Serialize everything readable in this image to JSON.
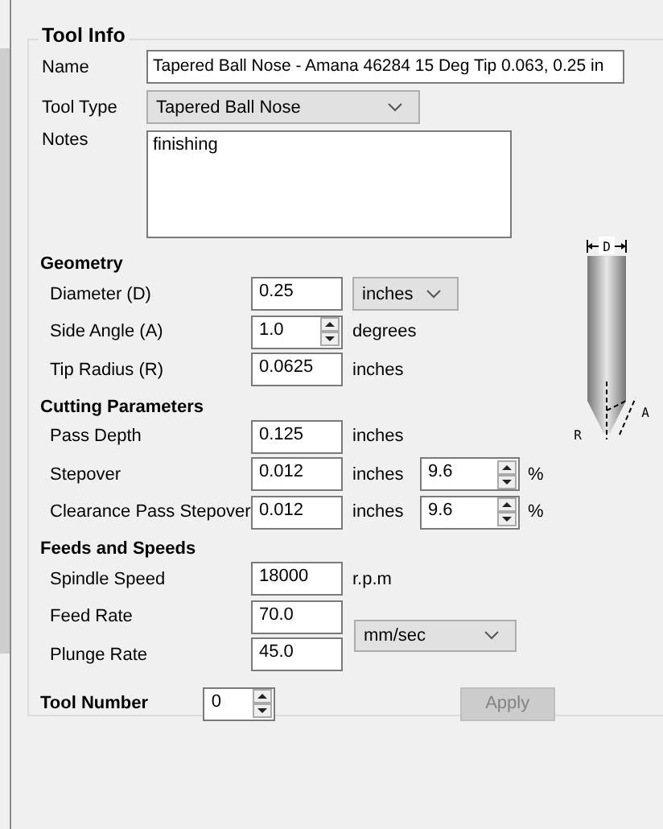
{
  "tool_info": {
    "title": "Tool Info",
    "name": {
      "label": "Name",
      "value": "Tapered Ball Nose - Amana 46284 15 Deg Tip 0.063, 0.25 in"
    },
    "tool_type": {
      "label": "Tool Type",
      "value": "Tapered Ball Nose"
    },
    "notes": {
      "label": "Notes",
      "value": "finishing"
    }
  },
  "sections": [
    {
      "title": "Geometry",
      "rows": [
        {
          "label": "Diameter (D)",
          "kind": "input",
          "value": "0.25",
          "unit_select": "inches"
        },
        {
          "label": "Side Angle (A)",
          "kind": "spin",
          "value": "1.0",
          "unit": "degrees"
        },
        {
          "label": "Tip Radius (R)",
          "kind": "input",
          "value": "0.0625",
          "unit": "inches"
        }
      ]
    },
    {
      "title": "Cutting Parameters",
      "rows": [
        {
          "label": "Pass Depth",
          "kind": "input",
          "value": "0.125",
          "unit": "inches"
        },
        {
          "label": "Stepover",
          "kind": "input",
          "value": "0.012",
          "unit": "inches",
          "percent": {
            "value": "9.6",
            "symbol": "%"
          }
        },
        {
          "label": "Clearance Pass Stepover",
          "kind": "input",
          "value": "0.012",
          "unit": "inches",
          "percent": {
            "value": "9.6",
            "symbol": "%"
          }
        }
      ]
    },
    {
      "title": "Feeds and Speeds",
      "shared_unit": "mm/sec",
      "rows": [
        {
          "label": "Spindle Speed",
          "kind": "input",
          "value": "18000",
          "unit": "r.p.m"
        },
        {
          "label": "Feed Rate",
          "kind": "input",
          "value": "70.0"
        },
        {
          "label": "Plunge Rate",
          "kind": "input",
          "value": "45.0"
        }
      ]
    }
  ],
  "tool_number": {
    "label": "Tool Number",
    "value": "0"
  },
  "apply_button": {
    "label": "Apply",
    "disabled": true
  },
  "drawing_labels": [
    "D",
    "A",
    "R"
  ]
}
